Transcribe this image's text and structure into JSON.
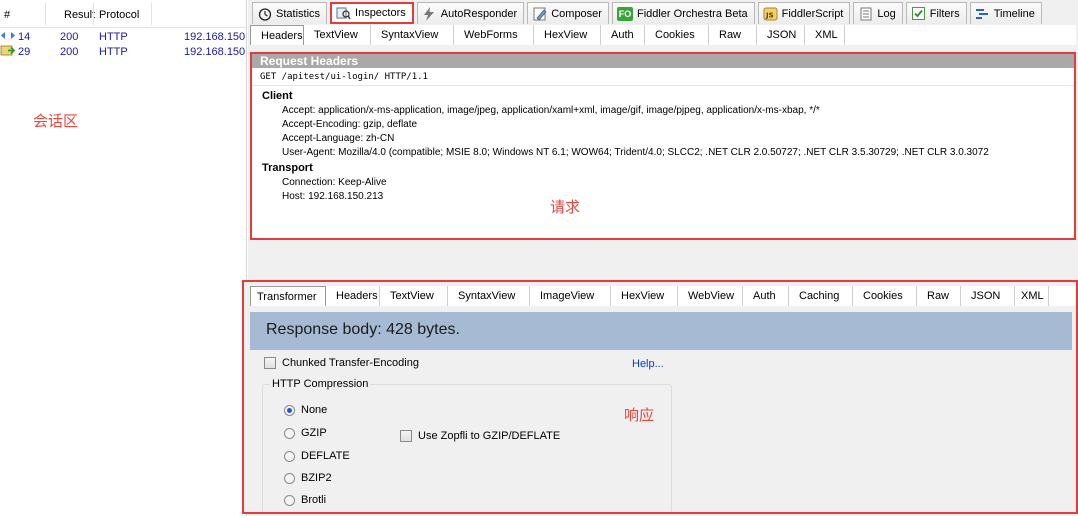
{
  "sessions": {
    "columns": [
      "#",
      "Result",
      "Protocol"
    ],
    "rows": [
      {
        "id": "14",
        "result": "200",
        "protocol": "HTTP",
        "host": "192.168.150"
      },
      {
        "id": "29",
        "result": "200",
        "protocol": "HTTP",
        "host": "192.168.150"
      }
    ],
    "zone_label": "会话区"
  },
  "top_tabs": [
    {
      "label": "Statistics",
      "icon": "stopwatch-icon"
    },
    {
      "label": "Inspectors",
      "icon": "inspector-icon"
    },
    {
      "label": "AutoResponder",
      "icon": "lightning-icon"
    },
    {
      "label": "Composer",
      "icon": "pencil-icon"
    },
    {
      "label": "Fiddler Orchestra Beta",
      "icon": "fo-icon"
    },
    {
      "label": "FiddlerScript",
      "icon": "script-icon"
    },
    {
      "label": "Log",
      "icon": "log-icon"
    },
    {
      "label": "Filters",
      "icon": "checkbox-icon"
    },
    {
      "label": "Timeline",
      "icon": "timeline-icon"
    }
  ],
  "request": {
    "tabs": [
      "Headers",
      "TextView",
      "SyntaxView",
      "WebForms",
      "HexView",
      "Auth",
      "Cookies",
      "Raw",
      "JSON",
      "XML"
    ],
    "title": "Request Headers",
    "request_line": "GET /apitest/ui-login/ HTTP/1.1",
    "groups": [
      {
        "name": "Client",
        "headers": [
          "Accept: application/x-ms-application, image/jpeg, application/xaml+xml, image/gif, image/pjpeg, application/x-ms-xbap, */*",
          "Accept-Encoding: gzip, deflate",
          "Accept-Language: zh-CN",
          "User-Agent: Mozilla/4.0 (compatible; MSIE 8.0; Windows NT 6.1; WOW64; Trident/4.0; SLCC2; .NET CLR 2.0.50727; .NET CLR 3.5.30729; .NET CLR 3.0.3072"
        ]
      },
      {
        "name": "Transport",
        "headers": [
          "Connection: Keep-Alive",
          "Host: 192.168.150.213"
        ]
      }
    ],
    "zone_label": "请求"
  },
  "response": {
    "tabs": [
      "Transformer",
      "Headers",
      "TextView",
      "SyntaxView",
      "ImageView",
      "HexView",
      "WebView",
      "Auth",
      "Caching",
      "Cookies",
      "Raw",
      "JSON",
      "XML"
    ],
    "body_label": "Response body: 428 bytes.",
    "chunked_label": "Chunked Transfer-Encoding",
    "help_label": "Help...",
    "compression_legend": "HTTP Compression",
    "compression_options": [
      {
        "label": "None",
        "selected": true
      },
      {
        "label": "GZIP",
        "selected": false
      },
      {
        "label": "DEFLATE",
        "selected": false
      },
      {
        "label": "BZIP2",
        "selected": false
      },
      {
        "label": "Brotli",
        "selected": false
      }
    ],
    "zopfli_label": "Use Zopfli to GZIP/DEFLATE",
    "zone_label": "响应"
  },
  "colors": {
    "highlight": "#e53b3b",
    "annotation": "#e8473c",
    "body_bar": "#a6bbd3"
  }
}
